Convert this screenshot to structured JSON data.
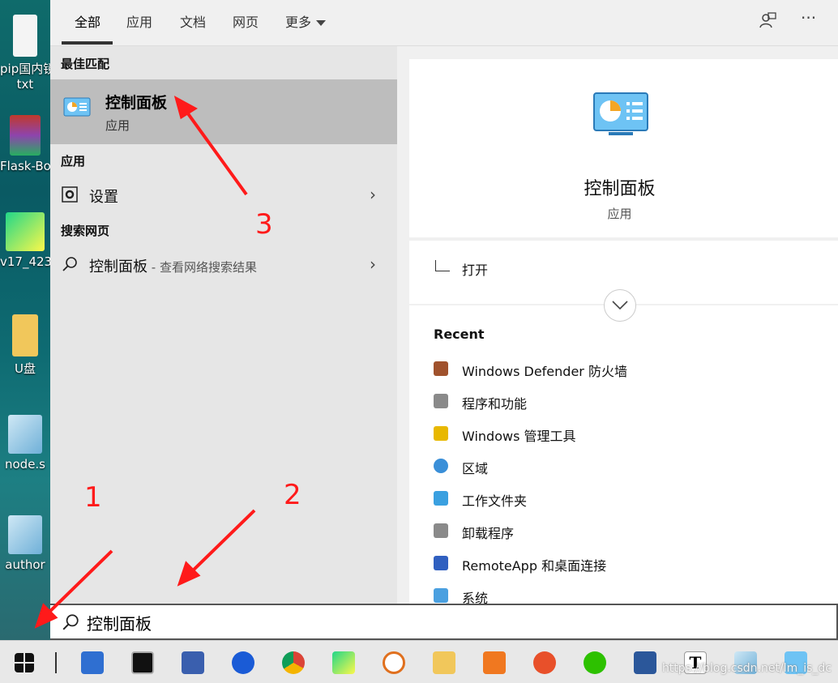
{
  "desktop": {
    "icons": [
      {
        "label": "pip国内镜",
        "label2": "txt"
      },
      {
        "label": "Flask-Bo"
      },
      {
        "label": "v17_423"
      },
      {
        "label": "U盘"
      },
      {
        "label": "node.s"
      },
      {
        "label": "author"
      }
    ]
  },
  "tabs": {
    "all": "全部",
    "apps": "应用",
    "docs": "文档",
    "web": "网页",
    "more": "更多"
  },
  "top_icons": {
    "feedback": "feedback-icon",
    "more": "···"
  },
  "left": {
    "best_match_heading": "最佳匹配",
    "best_match": {
      "title": "控制面板",
      "type": "应用"
    },
    "apps_heading": "应用",
    "settings_label": "设置",
    "web_heading": "搜索网页",
    "web_result": {
      "query": "控制面板",
      "suffix": " - 查看网络搜索结果"
    }
  },
  "right": {
    "title": "控制面板",
    "type": "应用",
    "open_label": "打开",
    "recent_heading": "Recent",
    "recent_items": [
      {
        "label": "Windows Defender 防火墙",
        "color": "#a0522d"
      },
      {
        "label": "程序和功能",
        "color": "#8a8a8a"
      },
      {
        "label": "Windows 管理工具",
        "color": "#e8b800"
      },
      {
        "label": "区域",
        "color": "#3a8fd8"
      },
      {
        "label": "工作文件夹",
        "color": "#3aa0e0"
      },
      {
        "label": "卸载程序",
        "color": "#8a8a8a"
      },
      {
        "label": "RemoteApp 和桌面连接",
        "color": "#3060c0"
      },
      {
        "label": "系统",
        "color": "#4aa0e0"
      }
    ]
  },
  "search": {
    "value": "控制面板"
  },
  "annotations": {
    "n1": "1",
    "n2": "2",
    "n3": "3"
  },
  "watermark": "https://blog.csdn.net/lm_is_dc",
  "colors": {
    "accent_red": "#ff1a1a",
    "selected_bg": "#bdbdbd"
  }
}
